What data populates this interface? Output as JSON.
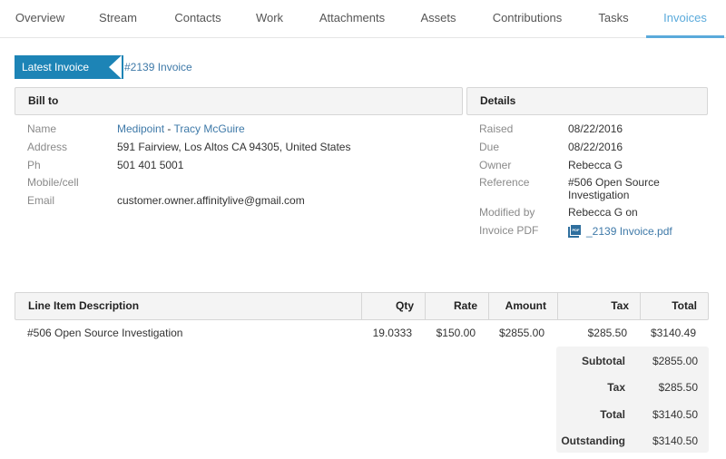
{
  "tabs": [
    {
      "label": "Overview",
      "active": false
    },
    {
      "label": "Stream",
      "active": false
    },
    {
      "label": "Contacts",
      "active": false
    },
    {
      "label": "Work",
      "active": false
    },
    {
      "label": "Attachments",
      "active": false
    },
    {
      "label": "Assets",
      "active": false
    },
    {
      "label": "Contributions",
      "active": false
    },
    {
      "label": "Tasks",
      "active": false
    },
    {
      "label": "Invoices",
      "active": true
    }
  ],
  "banner": {
    "label": "Latest Invoice",
    "invoice_link": "#2139 Invoice"
  },
  "bill_to": {
    "title": "Bill to",
    "name_label": "Name",
    "company": "Medipoint",
    "separator": " - ",
    "contact": "Tracy McGuire",
    "address_label": "Address",
    "address": "591 Fairview, Los Altos CA 94305, United States",
    "phone_label": "Ph",
    "phone": "501 401 5001",
    "mobile_label": "Mobile/cell",
    "mobile": "",
    "email_label": "Email",
    "email": "customer.owner.affinitylive@gmail.com"
  },
  "details": {
    "title": "Details",
    "raised_label": "Raised",
    "raised": "08/22/2016",
    "due_label": "Due",
    "due": "08/22/2016",
    "owner_label": "Owner",
    "owner": "Rebecca G",
    "reference_label": "Reference",
    "reference_line1": "#506 Open Source",
    "reference_line2": "Investigation",
    "modified_label": "Modified by",
    "modified": "Rebecca G on",
    "pdf_label": "Invoice PDF",
    "pdf_icon": "pdf-file-icon",
    "pdf_icon_text": "PDF",
    "pdf_file": "_2139 Invoice.pdf"
  },
  "table": {
    "headers": {
      "description": "Line Item Description",
      "qty": "Qty",
      "rate": "Rate",
      "amount": "Amount",
      "tax": "Tax",
      "total": "Total"
    },
    "rows": [
      {
        "description": "#506 Open Source Investigation",
        "qty": "19.0333",
        "rate": "$150.00",
        "amount": "$2855.00",
        "tax": "$285.50",
        "total": "$3140.49"
      }
    ]
  },
  "summary": {
    "subtotal_label": "Subtotal",
    "subtotal": "$2855.00",
    "tax_label": "Tax",
    "tax": "$285.50",
    "total_label": "Total",
    "total": "$3140.50",
    "outstanding_label": "Outstanding",
    "outstanding": "$3140.50"
  },
  "colors": {
    "accent": "#5aaadb",
    "banner": "#1d84b6",
    "link": "#3e79a8"
  }
}
